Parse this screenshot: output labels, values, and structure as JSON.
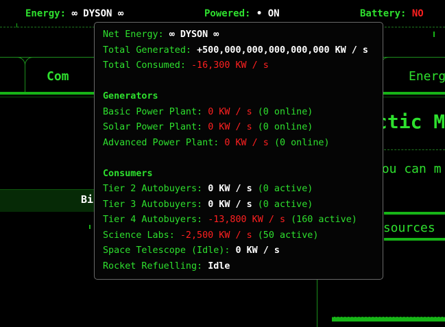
{
  "statusbar": {
    "energy_label": "Energy:",
    "energy_value": "∞ DYSON ∞",
    "powered_label": "Powered:",
    "powered_value": "• ON",
    "battery_label": "Battery:",
    "battery_value": "NO"
  },
  "page": {
    "tab_left_label": "Com",
    "tab_right_label": "Energ",
    "bi_label": "Bi",
    "heading_partial": "ctic M",
    "text_partial": "you can m",
    "resources_partial": "esources"
  },
  "tooltip": {
    "net_energy_label": "Net Energy:",
    "net_energy_value": "∞ DYSON ∞",
    "total_generated_label": "Total Generated:",
    "total_generated_value": "+500,000,000,000,000,000 KW / s",
    "total_consumed_label": "Total Consumed:",
    "total_consumed_value": "-16,300 KW / s",
    "generators_heading": "Generators",
    "generators": [
      {
        "label": "Basic Power Plant:",
        "value": "0 KW / s",
        "count": "(0 online)"
      },
      {
        "label": "Solar Power Plant:",
        "value": "0 KW / s",
        "count": "(0 online)"
      },
      {
        "label": "Advanced Power Plant:",
        "value": "0 KW / s",
        "count": "(0 online)"
      }
    ],
    "consumers_heading": "Consumers",
    "consumers": [
      {
        "label": "Tier 2 Autobuyers:",
        "value": "0 KW / s",
        "count": "(0 active)"
      },
      {
        "label": "Tier 3 Autobuyers:",
        "value": "0 KW / s",
        "count": "(0 active)"
      },
      {
        "label": "Tier 4 Autobuyers:",
        "value": "-13,800 KW / s",
        "count": "(160 active)"
      },
      {
        "label": "Science Labs:",
        "value": "-2,500 KW / s",
        "count": "(50 active)"
      },
      {
        "label": "Space Telescope (Idle):",
        "value": "0 KW / s",
        "count": ""
      },
      {
        "label": "Rocket Refuelling:",
        "value": "Idle",
        "count": ""
      }
    ]
  },
  "colors": {
    "accent_green": "#2ee02e",
    "negative_red": "#ff2020",
    "background": "#000000"
  }
}
